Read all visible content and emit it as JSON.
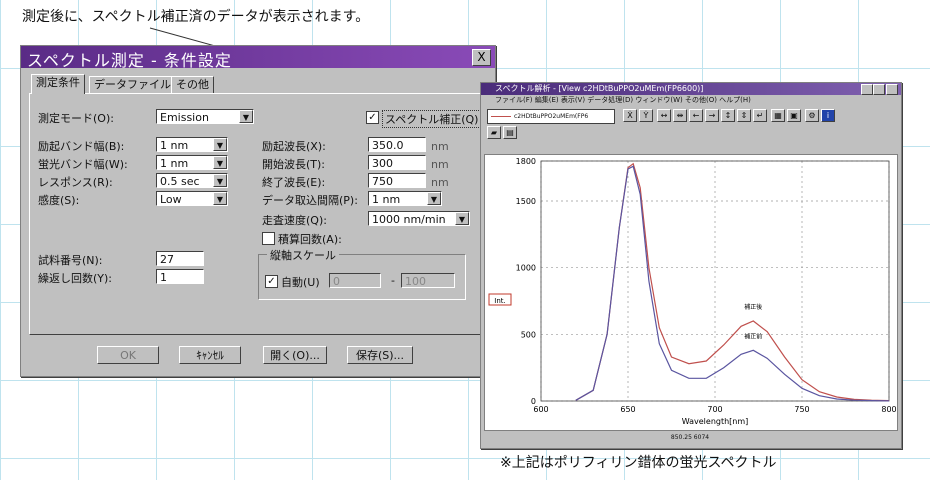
{
  "caption_top": "測定後に、スペクトル補正済のデータが表示されます。",
  "caption_bottom": "※上記はポリフィリン錯体の蛍光スペクトル",
  "dialog": {
    "title": "スペクトル測定 - 条件設定",
    "close": "X",
    "tabs": [
      "測定条件",
      "データファイル",
      "その他"
    ],
    "fields": {
      "mode_label": "測定モード(O):",
      "mode_value": "Emission",
      "correction_label": "スペクトル補正(Q)",
      "ex_band_label": "励起バンド幅(B):",
      "ex_band_value": "1 nm",
      "em_band_label": "蛍光バンド幅(W):",
      "em_band_value": "1 nm",
      "response_label": "レスポンス(R):",
      "response_value": "0.5 sec",
      "sensitivity_label": "感度(S):",
      "sensitivity_value": "Low",
      "ex_wl_label": "励起波長(X):",
      "ex_wl_value": "350.0",
      "start_wl_label": "開始波長(T):",
      "start_wl_value": "300",
      "end_wl_label": "終了波長(E):",
      "end_wl_value": "750",
      "interval_label": "データ取込間隔(P):",
      "interval_value": "1 nm",
      "speed_label": "走査速度(Q):",
      "speed_value": "1000 nm/min",
      "accum_label": "積算回数(A):",
      "sample_label": "試料番号(N):",
      "sample_value": "27",
      "repeat_label": "繰返し回数(Y):",
      "repeat_value": "1",
      "unit_nm": "nm",
      "scale_group": "縦軸スケール",
      "auto_label": "自動(U)",
      "scale_min": "0",
      "scale_dash": "-",
      "scale_max": "100"
    },
    "buttons": {
      "ok": "OK",
      "cancel": "ｷｬﾝｾﾙ",
      "open": "開く(O)...",
      "save": "保存(S)..."
    }
  },
  "analysis_window": {
    "title": "スペクトル解析 - [View c2HDtBuPPO2uMEm(FP6600)]",
    "menu": "ファイル(F)  編集(E)  表示(V)  データ処理(D)  ウィンドウ(W)  その他(O)  ヘルプ(H)",
    "combo": "c2HDtBuPPO2uMEm(FP6",
    "ylabel": "Int.",
    "xlabel": "Wavelength[nm]",
    "status": "850.25 6074"
  },
  "chart_data": {
    "type": "line",
    "xlabel": "Wavelength[nm]",
    "ylabel": "Int.",
    "xlim": [
      600,
      800
    ],
    "ylim": [
      0,
      1800
    ],
    "xticks": [
      600,
      650,
      700,
      750,
      800
    ],
    "yticks": [
      0,
      500,
      1000,
      1500,
      1800
    ],
    "grid": true,
    "series": [
      {
        "name": "補正後",
        "color": "#c0504d",
        "x": [
          620,
          630,
          638,
          645,
          650,
          653,
          657,
          662,
          668,
          675,
          685,
          695,
          705,
          715,
          722,
          730,
          740,
          750,
          760,
          770,
          780,
          790,
          800
        ],
        "y": [
          5,
          80,
          500,
          1300,
          1750,
          1780,
          1600,
          1000,
          550,
          330,
          280,
          300,
          420,
          560,
          600,
          520,
          330,
          160,
          70,
          30,
          12,
          6,
          3
        ]
      },
      {
        "name": "補正前",
        "color": "#5a55a0",
        "x": [
          620,
          630,
          638,
          645,
          650,
          653,
          657,
          662,
          668,
          675,
          685,
          695,
          705,
          715,
          722,
          730,
          740,
          750,
          760,
          770,
          780,
          790,
          800
        ],
        "y": [
          5,
          80,
          500,
          1300,
          1740,
          1760,
          1550,
          900,
          430,
          230,
          170,
          170,
          250,
          350,
          380,
          320,
          200,
          95,
          40,
          15,
          6,
          3,
          1
        ]
      }
    ]
  }
}
